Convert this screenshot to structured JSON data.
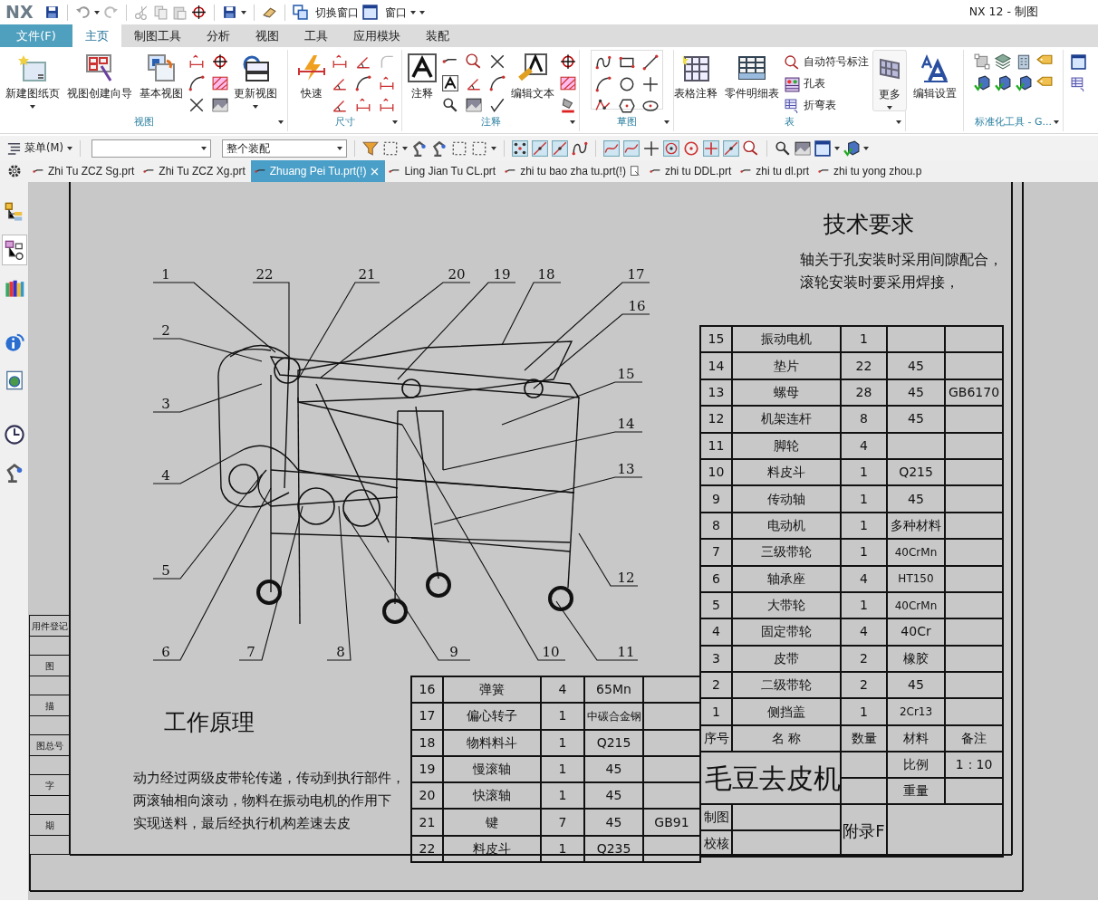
{
  "quick_access": {
    "logo": "NX",
    "switch_window": "切换窗口",
    "window_menu": "窗口"
  },
  "window": {
    "title": "NX 12 - 制图"
  },
  "menu_tabs": [
    {
      "label": "文件(F)",
      "kind": "file",
      "selected": false
    },
    {
      "label": "主页",
      "kind": "tab",
      "selected": true
    },
    {
      "label": "制图工具",
      "kind": "tab",
      "selected": false
    },
    {
      "label": "分析",
      "kind": "tab",
      "selected": false
    },
    {
      "label": "视图",
      "kind": "tab",
      "selected": false
    },
    {
      "label": "工具",
      "kind": "tab",
      "selected": false
    },
    {
      "label": "应用模块",
      "kind": "tab",
      "selected": false
    },
    {
      "label": "装配",
      "kind": "tab",
      "selected": false
    }
  ],
  "ribbon_groups": [
    {
      "label": "视图",
      "buttons": [
        {
          "label": "新建图纸页"
        },
        {
          "label": "视图创建向导"
        },
        {
          "label": "基本视图"
        },
        {
          "label": "更新视图"
        }
      ]
    },
    {
      "label": "尺寸",
      "buttons": [
        {
          "label": "快速"
        }
      ]
    },
    {
      "label": "注释",
      "buttons": [
        {
          "label": "注释"
        },
        {
          "label": "编辑文本"
        }
      ]
    },
    {
      "label": "草图"
    },
    {
      "label": "表",
      "buttons": [
        {
          "label": "表格注释"
        },
        {
          "label": "零件明细表"
        },
        {
          "label": "更多"
        }
      ],
      "list_buttons": [
        {
          "label": "自动符号标注"
        },
        {
          "label": "孔表"
        },
        {
          "label": "折弯表"
        }
      ]
    },
    {
      "buttons": [
        {
          "label": "编辑设置"
        }
      ]
    },
    {
      "label": "标准化工具 - G..."
    }
  ],
  "toolbar": {
    "menu": "菜单(M)",
    "assembly_filter": "整个装配"
  },
  "file_tabs": [
    {
      "label": "Zhi Tu ZCZ Sg.prt",
      "selected": false
    },
    {
      "label": "Zhi Tu ZCZ Xg.prt",
      "selected": false
    },
    {
      "label": "Zhuang Pei Tu.prt(!)",
      "selected": true
    },
    {
      "label": "Ling Jian Tu CL.prt",
      "selected": false
    },
    {
      "label": "zhi tu bao zha tu.prt(!)",
      "selected": false
    },
    {
      "label": "zhi tu DDL.prt",
      "selected": false
    },
    {
      "label": "zhi tu dl.prt",
      "selected": false
    },
    {
      "label": "zhi tu yong zhou.p",
      "selected": false
    }
  ],
  "sidebar": {
    "items": [
      {
        "selected": false
      },
      {
        "selected": true
      },
      {
        "selected": false
      },
      {
        "selected": false
      },
      {
        "selected": false
      },
      {
        "selected": false
      },
      {
        "selected": false
      }
    ]
  },
  "drawing": {
    "technical_requirements": {
      "title": "技术要求",
      "lines": [
        "轴关于孔安装时采用间隙配合，",
        "滚轮安装时要采用焊接，"
      ]
    },
    "callouts": [
      {
        "label": "1"
      },
      {
        "label": "22"
      },
      {
        "label": "21"
      },
      {
        "label": "20"
      },
      {
        "label": "19"
      },
      {
        "label": "18"
      },
      {
        "label": "17"
      },
      {
        "label": "16"
      },
      {
        "label": "2"
      },
      {
        "label": "15"
      },
      {
        "label": "3"
      },
      {
        "label": "14"
      },
      {
        "label": "13"
      },
      {
        "label": "4"
      },
      {
        "label": "5"
      },
      {
        "label": "12"
      },
      {
        "label": "6"
      },
      {
        "label": "7"
      },
      {
        "label": "8"
      },
      {
        "label": "9"
      },
      {
        "label": "10"
      },
      {
        "label": "11"
      }
    ],
    "parts_list": [
      {
        "no": "15",
        "name": "振动电机",
        "qty": "1"
      },
      {
        "no": "14",
        "name": "垫片",
        "qty": "22",
        "material": "45"
      },
      {
        "no": "13",
        "name": "螺母",
        "qty": "28",
        "material": "45",
        "note": "GB6170"
      },
      {
        "no": "12",
        "name": "机架连杆",
        "qty": "8",
        "material": "45"
      },
      {
        "no": "11",
        "name": "脚轮",
        "qty": "4"
      },
      {
        "no": "10",
        "name": "料皮斗",
        "qty": "1",
        "material": "Q215"
      },
      {
        "no": "9",
        "name": "传动轴",
        "qty": "1",
        "material": "45"
      },
      {
        "no": "8",
        "name": "电动机",
        "qty": "1",
        "material": "多种材料"
      },
      {
        "no": "7",
        "name": "三级带轮",
        "qty": "1",
        "material": "40CrMn"
      },
      {
        "no": "6",
        "name": "轴承座",
        "qty": "4",
        "material": "HT150"
      },
      {
        "no": "5",
        "name": "大带轮",
        "qty": "1",
        "material": "40CrMn"
      },
      {
        "no": "4",
        "name": "固定带轮",
        "qty": "4",
        "material": "40Cr"
      },
      {
        "no": "3",
        "name": "皮带",
        "qty": "2",
        "material": "橡胶"
      },
      {
        "no": "2",
        "name": "二级带轮",
        "qty": "2",
        "material": "45"
      },
      {
        "no": "1",
        "name": "侧挡盖",
        "qty": "1",
        "material": "2Cr13"
      }
    ],
    "parts_header": {
      "no": "序号",
      "name": "名 称",
      "qty": "数量",
      "material": "材料",
      "note": "备注"
    },
    "title_block": {
      "product": "毛豆去皮机",
      "scale_label": "比例",
      "scale": "1：10",
      "weight_label": "重量",
      "drawn_label": "制图",
      "checked_label": "校核",
      "appendix": "附录F"
    },
    "extra_parts": [
      {
        "no": "16",
        "name": "弹簧",
        "qty": "4",
        "material": "65Mn"
      },
      {
        "no": "17",
        "name": "偏心转子",
        "qty": "1",
        "material": "中碳合金钢"
      },
      {
        "no": "18",
        "name": "物料料斗",
        "qty": "1",
        "material": "Q215"
      },
      {
        "no": "19",
        "name": "慢滚轴",
        "qty": "1",
        "material": "45"
      },
      {
        "no": "20",
        "name": "快滚轴",
        "qty": "1",
        "material": "45"
      },
      {
        "no": "21",
        "name": "键",
        "qty": "7",
        "material": "45",
        "note": "GB91"
      },
      {
        "no": "22",
        "name": "料皮斗",
        "qty": "1",
        "material": "Q235"
      }
    ],
    "working_principle": {
      "title": "工作原理",
      "lines": [
        "动力经过两级皮带轮传递，传动到执行部件，",
        "两滚轴相向滚动，物料在振动电机的作用下",
        "实现送料，最后经执行机构差速去皮"
      ]
    },
    "side_strip": [
      {
        "label": "用件登记"
      },
      {
        "label": "图"
      },
      {
        "label": "描"
      },
      {
        "label": "图总号"
      },
      {
        "label": "字"
      },
      {
        "label": "期"
      }
    ]
  }
}
